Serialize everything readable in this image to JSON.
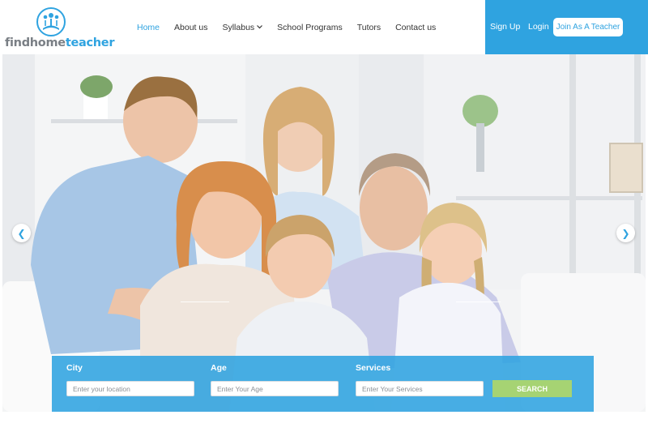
{
  "brand": {
    "name_part1": "findhome",
    "name_part2": "teacher",
    "accent": "#2fa3e0"
  },
  "nav": {
    "items": [
      {
        "label": "Home",
        "active": true
      },
      {
        "label": "About us",
        "active": false
      },
      {
        "label": "Syllabus",
        "active": false,
        "has_dropdown": true,
        "icon": "chevron-down-icon"
      },
      {
        "label": "School Programs",
        "active": false
      },
      {
        "label": "Tutors",
        "active": false
      },
      {
        "label": "Contact us",
        "active": false
      }
    ]
  },
  "account": {
    "signup_label": "Sign Up",
    "login_label": "Login",
    "join_label": "Join As A Teacher"
  },
  "carousel": {
    "prev_icon": "chevron-left-icon",
    "next_icon": "chevron-right-icon",
    "prev_glyph": "❮",
    "next_glyph": "❯"
  },
  "search": {
    "city": {
      "label": "City",
      "placeholder": "Enter your location"
    },
    "age": {
      "label": "Age",
      "placeholder": "Enter Your Age"
    },
    "services": {
      "label": "Services",
      "placeholder": "Enter Your Services"
    },
    "button_label": "SEARCH",
    "button_color": "#a6d373"
  }
}
